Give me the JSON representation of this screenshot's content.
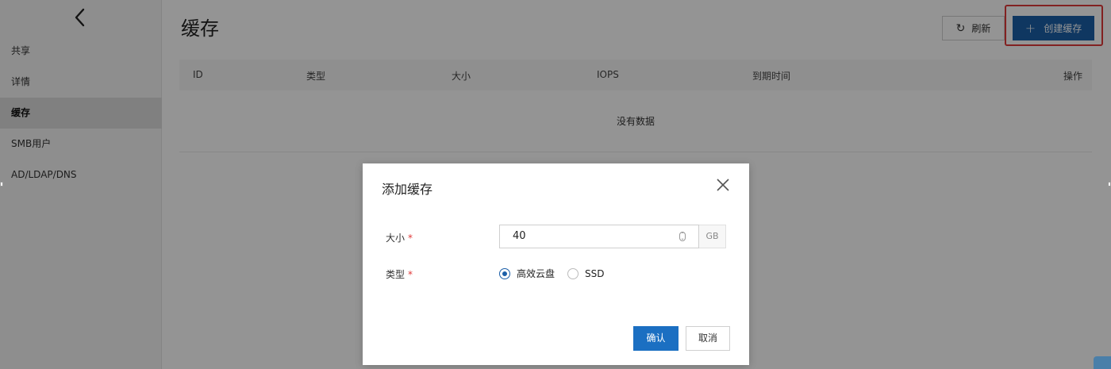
{
  "sidebar": {
    "back_icon": "chevron-left-icon",
    "items": [
      {
        "label": "共享",
        "active": false
      },
      {
        "label": "详情",
        "active": false
      },
      {
        "label": "缓存",
        "active": true
      },
      {
        "label": "SMB用户",
        "active": false
      },
      {
        "label": "AD/LDAP/DNS",
        "active": false
      }
    ]
  },
  "header": {
    "title": "缓存",
    "refresh_label": "刷新",
    "create_label": "创建缓存"
  },
  "table": {
    "columns": [
      "ID",
      "类型",
      "大小",
      "IOPS",
      "到期时间",
      "操作"
    ],
    "empty_text": "没有数据"
  },
  "modal": {
    "title": "添加缓存",
    "size_label": "大小",
    "size_value": "40",
    "size_unit": "GB",
    "type_label": "类型",
    "required_mark": "*",
    "type_options": [
      {
        "label": "高效云盘",
        "checked": true
      },
      {
        "label": "SSD",
        "checked": false
      }
    ],
    "ok_label": "确认",
    "cancel_label": "取消"
  },
  "colors": {
    "primary": "#1b5fa8",
    "confirm": "#1b6fc2",
    "highlight": "#e03a3a",
    "required": "#e03a3a"
  }
}
